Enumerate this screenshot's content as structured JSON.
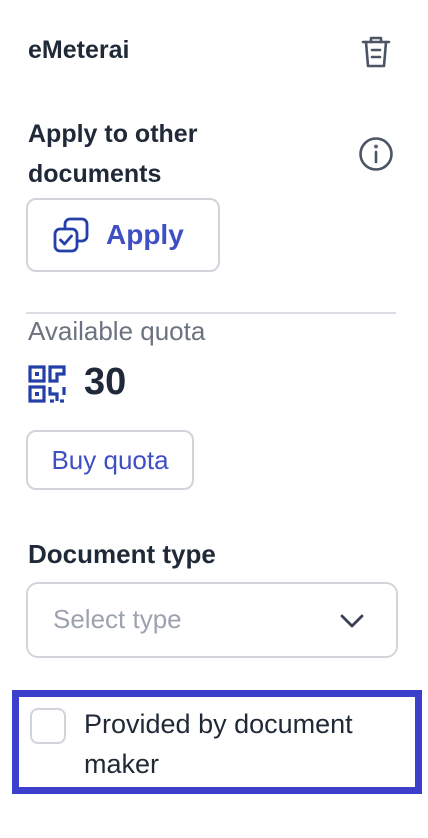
{
  "header": {
    "title": "eMeterai",
    "delete_icon": "trash-icon"
  },
  "apply_section": {
    "title": "Apply to other documents",
    "info_icon": "info-icon",
    "button_label": "Apply",
    "button_icon": "copy-check-icon"
  },
  "quota": {
    "label": "Available quota",
    "value": "30",
    "icon": "qr-code-icon",
    "buy_label": "Buy quota"
  },
  "document_type": {
    "label": "Document type",
    "placeholder": "Select type",
    "chevron_icon": "chevron-down-icon"
  },
  "provided_by": {
    "label": "Provided by document maker",
    "checked": false
  },
  "colors": {
    "accent": "#3f4fc4",
    "highlight": "#3b3fc9"
  }
}
